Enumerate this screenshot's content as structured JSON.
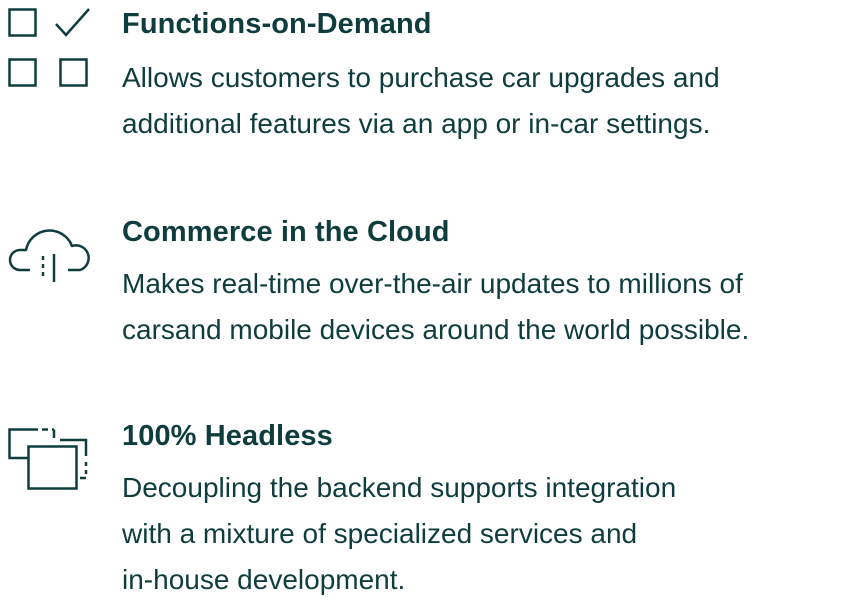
{
  "features": [
    {
      "icon": "checklist-icon",
      "title": "Functions-on-Demand",
      "description_lines": [
        "Allows customers to purchase car upgrades and",
        "additional features via an app or in-car settings."
      ]
    },
    {
      "icon": "cloud-icon",
      "title": "Commerce in the Cloud",
      "description_lines": [
        "Makes real-time over-the-air updates to millions of",
        "carsand mobile devices around the world possible."
      ]
    },
    {
      "icon": "decoupled-blocks-icon",
      "title": "100% Headless",
      "description_lines": [
        "Decoupling the backend supports integration",
        "with a mixture of specialized services and",
        "in-house development."
      ]
    }
  ],
  "colors": {
    "text": "#0f3d3e",
    "icon_stroke": "#0f3d3e"
  }
}
